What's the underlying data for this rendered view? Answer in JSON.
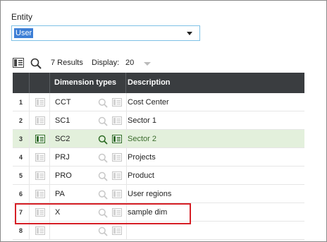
{
  "entity": {
    "label": "Entity",
    "selected": "User"
  },
  "toolbar": {
    "results": "7 Results",
    "display_label": "Display:",
    "display_value": "20"
  },
  "table": {
    "headers": {
      "dimension_types": "Dimension types",
      "description": "Description"
    },
    "rows": [
      {
        "num": "1",
        "code": "CCT",
        "description": "Cost Center",
        "selected": false
      },
      {
        "num": "2",
        "code": "SC1",
        "description": "Sector 1",
        "selected": false
      },
      {
        "num": "3",
        "code": "SC2",
        "description": "Sector 2",
        "selected": true
      },
      {
        "num": "4",
        "code": "PRJ",
        "description": "Projects",
        "selected": false
      },
      {
        "num": "5",
        "code": "PRO",
        "description": "Product",
        "selected": false
      },
      {
        "num": "6",
        "code": "PA",
        "description": "User regions",
        "selected": false
      },
      {
        "num": "7",
        "code": "X",
        "description": "sample dim",
        "selected": false
      },
      {
        "num": "8",
        "code": "",
        "description": "",
        "selected": false
      }
    ]
  },
  "colors": {
    "header_bg": "#3a3d40",
    "selected_row_bg": "#e3f0dc",
    "highlight_border": "#d61f26",
    "select_border": "#7ec1e6",
    "selected_text_bg": "#3d7fd6"
  },
  "icons": {
    "toolbar": [
      "form-view-icon",
      "search-icon"
    ],
    "row": [
      "form-icon",
      "search-icon",
      "card-icon"
    ]
  }
}
